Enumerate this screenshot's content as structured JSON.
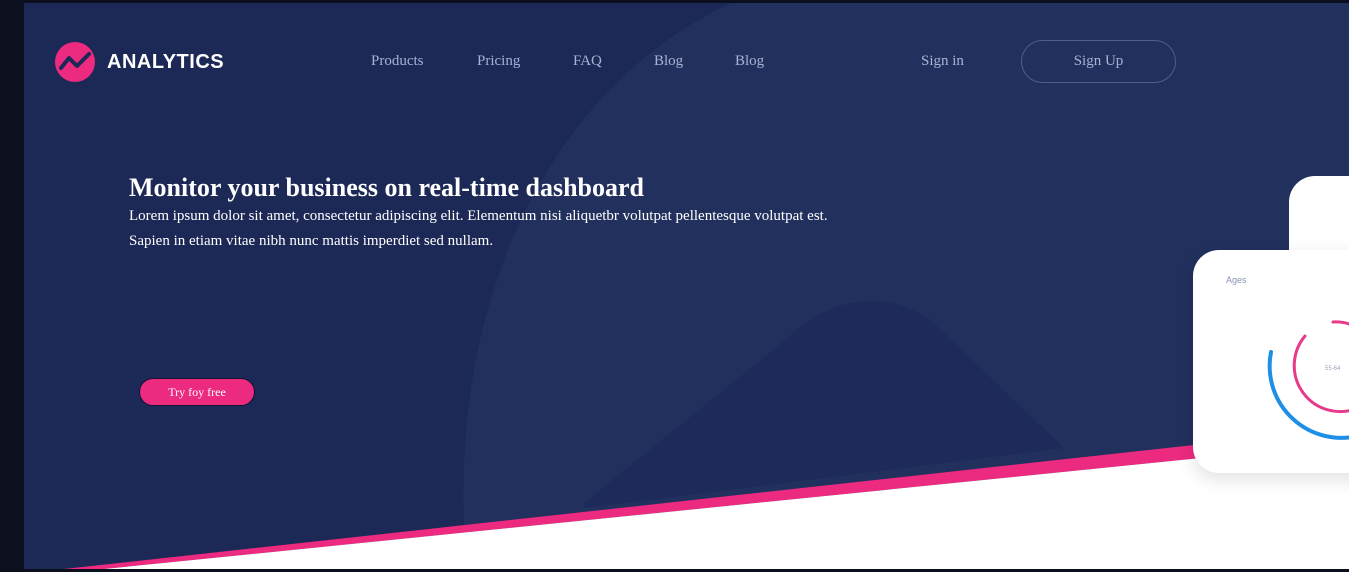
{
  "brand": {
    "name": "ANALYTICS"
  },
  "nav": {
    "items": [
      "Products",
      "Pricing",
      "FAQ",
      "Blog",
      "Blog"
    ],
    "signin_label": "Sign in",
    "signup_label": "Sign Up"
  },
  "hero": {
    "headline": "Monitor your business on real-time dashboard",
    "subtext": "Lorem ipsum dolor sit amet, consectetur adipiscing elit. Elementum nisi aliquetbr volutpat pellentesque volutpat est. Sapien in etiam vitae nibh nunc mattis imperdiet sed nullam.",
    "cta_label": "Try foy free"
  },
  "card": {
    "title": "Ages",
    "center_label": "55-64"
  },
  "colors": {
    "background": "#1c2856",
    "accent": "#ec2a7f",
    "chart_blue": "#1e8fe6",
    "text_muted": "#aab2d3"
  }
}
